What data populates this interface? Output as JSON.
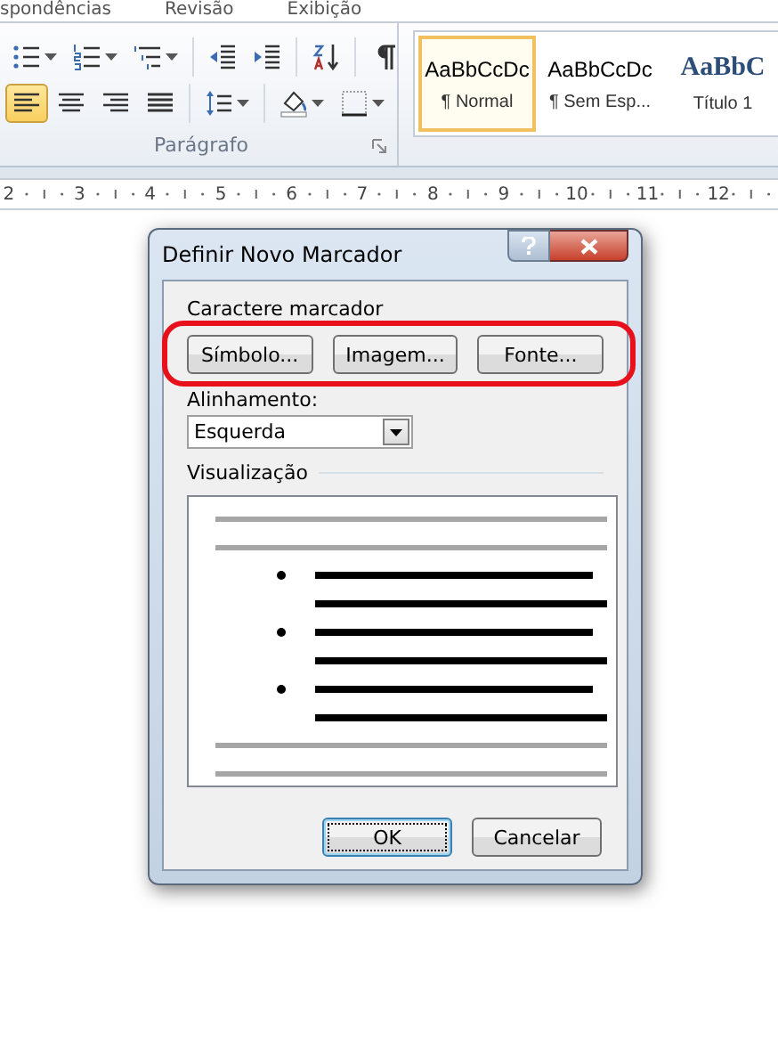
{
  "ribbon_tabs": [
    {
      "label": "spondências"
    },
    {
      "label": "Revisão"
    },
    {
      "label": "Exibição"
    }
  ],
  "paragraph_group": {
    "title": "Parágrafo",
    "rows": [
      [
        {
          "kind": "bullets",
          "dropdown": true,
          "selected": false
        },
        {
          "kind": "numbering",
          "dropdown": true,
          "selected": false
        },
        {
          "kind": "multilevel",
          "dropdown": true,
          "selected": false
        },
        {
          "kind": "outdent",
          "dropdown": false,
          "selected": false
        },
        {
          "kind": "indent",
          "dropdown": false,
          "selected": false
        },
        {
          "kind": "sort",
          "dropdown": false,
          "selected": false
        },
        {
          "kind": "pilcrow",
          "dropdown": false,
          "selected": false
        }
      ],
      [
        {
          "kind": "align-left",
          "dropdown": false,
          "selected": true
        },
        {
          "kind": "align-center",
          "dropdown": false,
          "selected": false
        },
        {
          "kind": "align-right",
          "dropdown": false,
          "selected": false
        },
        {
          "kind": "justify",
          "dropdown": false,
          "selected": false
        },
        {
          "kind": "line-spacing",
          "dropdown": true,
          "selected": false
        },
        {
          "kind": "shading",
          "dropdown": true,
          "selected": false
        },
        {
          "kind": "borders",
          "dropdown": true,
          "selected": false
        }
      ]
    ]
  },
  "styles": [
    {
      "preview": "AaBbCcDc",
      "label": "¶ Normal",
      "kind": "body",
      "selected": true
    },
    {
      "preview": "AaBbCcDc",
      "label": "¶ Sem Esp...",
      "kind": "body",
      "selected": false
    },
    {
      "preview": "AaBbC",
      "label": "Título 1",
      "kind": "heading",
      "selected": false
    }
  ],
  "ruler": {
    "numbers": [
      "2",
      "3",
      "4",
      "5",
      "6",
      "7",
      "8",
      "9",
      "10",
      "11",
      "12"
    ]
  },
  "dialog": {
    "title": "Definir Novo Marcador",
    "highlight": true,
    "bullet_character": {
      "label": "Caractere marcador",
      "buttons": [
        "Símbolo...",
        "Imagem...",
        "Fonte..."
      ]
    },
    "alignment": {
      "label": "Alinhamento:",
      "value": "Esquerda"
    },
    "preview": {
      "label": "Visualização"
    },
    "buttons": [
      {
        "label": "OK",
        "default": true
      },
      {
        "label": "Cancelar",
        "default": false
      }
    ]
  }
}
